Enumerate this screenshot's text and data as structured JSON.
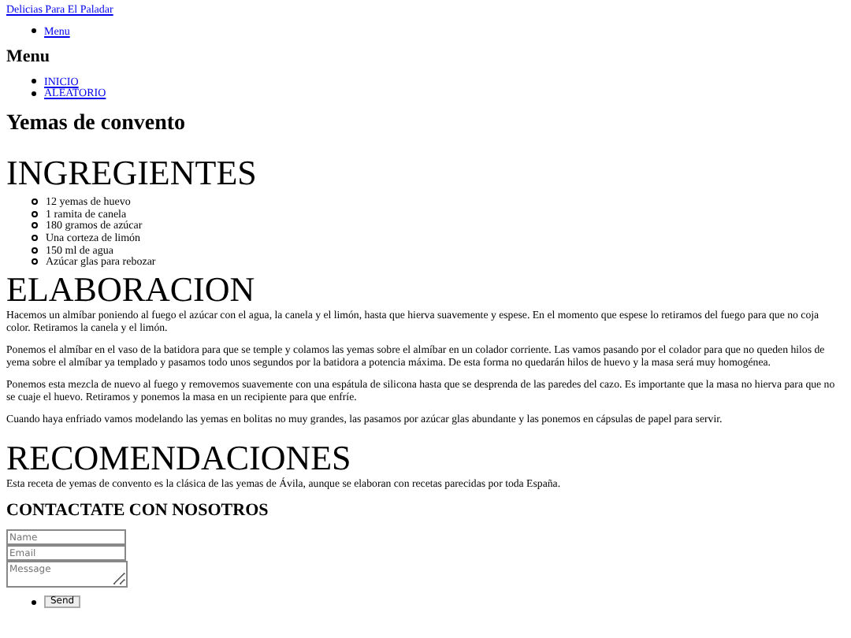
{
  "site_link": "Delicias Para El Paladar",
  "top_menu": [
    "Menu"
  ],
  "menu_heading": "Menu",
  "menu_items": [
    "INICIO",
    "ALEATORIO"
  ],
  "page_title": "Yemas de convento",
  "sections": [
    {
      "kind": "list",
      "heading": "INGREGIENTES",
      "items": [
        "12 yemas de huevo",
        "1 ramita de canela",
        "180 gramos de azúcar",
        "Una corteza de limón",
        "150 ml de agua",
        "Azúcar glas para rebozar"
      ]
    },
    {
      "kind": "text",
      "heading": "ELABORACION",
      "paragraphs": [
        "Hacemos un almíbar poniendo al fuego el azúcar con el agua, la canela y el limón, hasta que hierva suavemente y espese. En el momento que espese lo retiramos del fuego para que no coja color. Retiramos la canela y el limón.",
        "Ponemos el almíbar en el vaso de la batidora para que se temple y colamos las yemas sobre el almíbar en un colador corriente. Las vamos pasando por el colador para que no queden hilos de yema sobre el almíbar ya templado y pasamos todo unos segundos por la batidora a potencia máxima. De esta forma no quedarán hilos de huevo y la masa será muy homogénea.",
        "Ponemos esta mezcla de nuevo al fuego y removemos suavemente con una espátula de silicona hasta que se desprenda de las paredes del cazo. Es importante que la masa no hierva para que no se cuaje el huevo. Retiramos y ponemos la masa en un recipiente para que enfríe.",
        "Cuando haya enfriado vamos modelando las yemas en bolitas no muy grandes, las pasamos por azúcar glas abundante y las ponemos en cápsulas de papel para servir."
      ]
    },
    {
      "kind": "text",
      "heading": "RECOMENDACIONES",
      "paragraphs": [
        "Esta receta de yemas de convento es la clásica de las yemas de Ávila, aunque se elaboran con recetas parecidas por toda España."
      ]
    }
  ],
  "contact": {
    "heading": "CONTACTATE CON NOSOTROS",
    "name": {
      "placeholder": "Name"
    },
    "email": {
      "placeholder": "Email"
    },
    "message": {
      "placeholder": "Message"
    },
    "send": "Send"
  }
}
